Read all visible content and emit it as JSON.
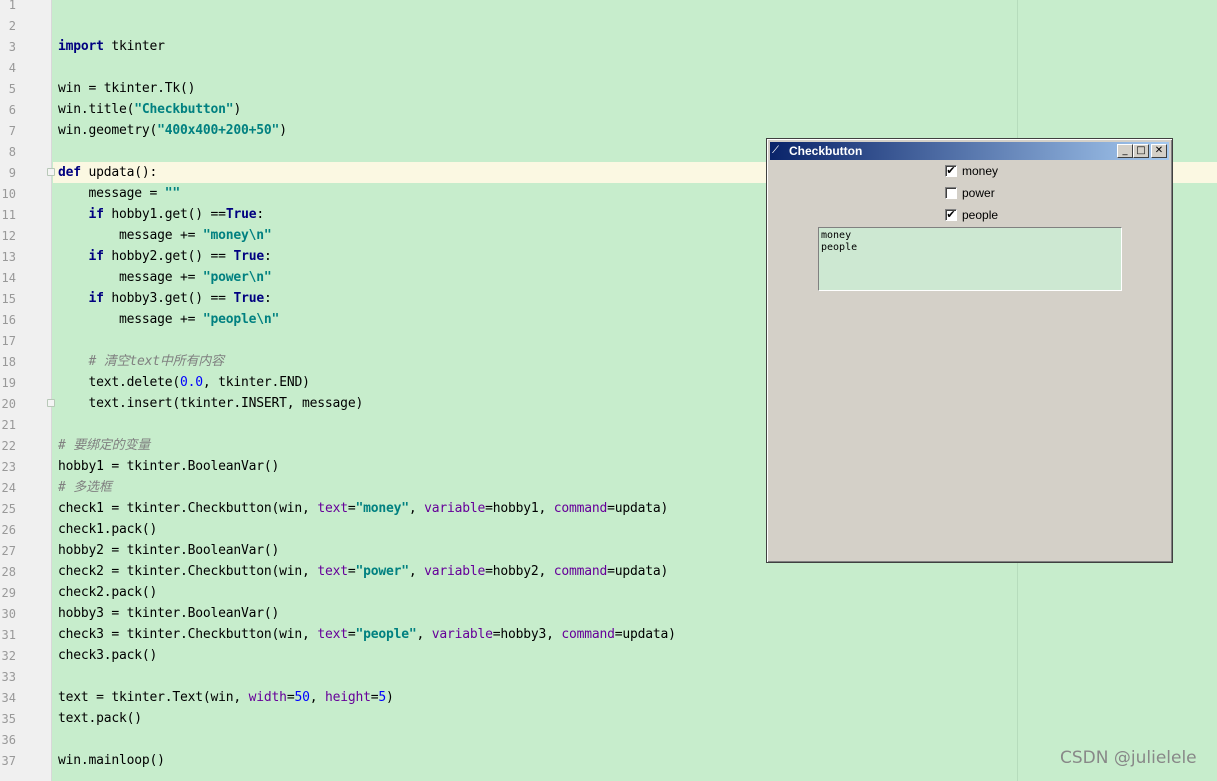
{
  "editor": {
    "line_numbers": [
      "1",
      "2",
      "3",
      "4",
      "5",
      "6",
      "7",
      "8",
      "9",
      "10",
      "11",
      "12",
      "13",
      "14",
      "15",
      "16",
      "17",
      "18",
      "19",
      "20",
      "21",
      "22",
      "23",
      "24",
      "25",
      "26",
      "27",
      "28",
      "29",
      "30",
      "31",
      "32",
      "33",
      "34",
      "35",
      "36",
      "37"
    ],
    "lines": {
      "l3": [
        "import",
        " tkinter"
      ],
      "l5": "win = tkinter.Tk()",
      "l6": [
        "win.title(",
        "\"Checkbutton\"",
        ")"
      ],
      "l7": [
        "win.geometry(",
        "\"400x400+200+50\"",
        ")"
      ],
      "l9": [
        "def",
        " updata():"
      ],
      "l10": [
        "    message = ",
        "\"\""
      ],
      "l11": [
        "    ",
        "if",
        " hobby1.get() ==",
        "True",
        ":"
      ],
      "l12": [
        "        message += ",
        "\"money\\n\""
      ],
      "l13": [
        "    ",
        "if",
        " hobby2.get() == ",
        "True",
        ":"
      ],
      "l14": [
        "        message += ",
        "\"power\\n\""
      ],
      "l15": [
        "    ",
        "if",
        " hobby3.get() == ",
        "True",
        ":"
      ],
      "l16": [
        "        message += ",
        "\"people\\n\""
      ],
      "l18": [
        "    ",
        "# 清空text中所有内容"
      ],
      "l19": [
        "    text.delete(",
        "0.0",
        ", tkinter.END)"
      ],
      "l20": "    text.insert(tkinter.INSERT, message)",
      "l22": "# 要绑定的变量",
      "l23": "hobby1 = tkinter.BooleanVar()",
      "l24": "# 多选框",
      "l25": [
        "check1 = tkinter.Checkbutton(win, ",
        "text",
        "=",
        "\"money\"",
        ", ",
        "variable",
        "=hobby1, ",
        "command",
        "=updata)"
      ],
      "l26": "check1.pack()",
      "l27": "hobby2 = tkinter.BooleanVar()",
      "l28": [
        "check2 = tkinter.Checkbutton(win, ",
        "text",
        "=",
        "\"power\"",
        ", ",
        "variable",
        "=hobby2, ",
        "command",
        "=updata)"
      ],
      "l29": "check2.pack()",
      "l30": "hobby3 = tkinter.BooleanVar()",
      "l31": [
        "check3 = tkinter.Checkbutton(win, ",
        "text",
        "=",
        "\"people\"",
        ", ",
        "variable",
        "=hobby3, ",
        "command",
        "=updata)"
      ],
      "l32": "check3.pack()",
      "l34": [
        "text = tkinter.Text(win, ",
        "width",
        "=",
        "50",
        ", ",
        "height",
        "=",
        "5",
        ")"
      ],
      "l35": "text.pack()",
      "l37": "win.mainloop()"
    }
  },
  "tk_window": {
    "title": "Checkbutton",
    "title_icon": "feather-icon",
    "buttons": {
      "minimize": "_",
      "maximize": "□",
      "close": "✕"
    },
    "checkboxes": [
      {
        "label": "money",
        "checked": true,
        "mark": "✔"
      },
      {
        "label": "power",
        "checked": false,
        "mark": ""
      },
      {
        "label": "people",
        "checked": true,
        "mark": "✔"
      }
    ],
    "text_content": "money\npeople"
  },
  "watermark": "CSDN @julielele",
  "colors": {
    "editor_bg": "#c7edcc",
    "keyword": "#000080",
    "string": "#008080",
    "param": "#660099",
    "comment": "#808080",
    "titlebar_start": "#0a246a",
    "titlebar_end": "#a6caf0"
  }
}
